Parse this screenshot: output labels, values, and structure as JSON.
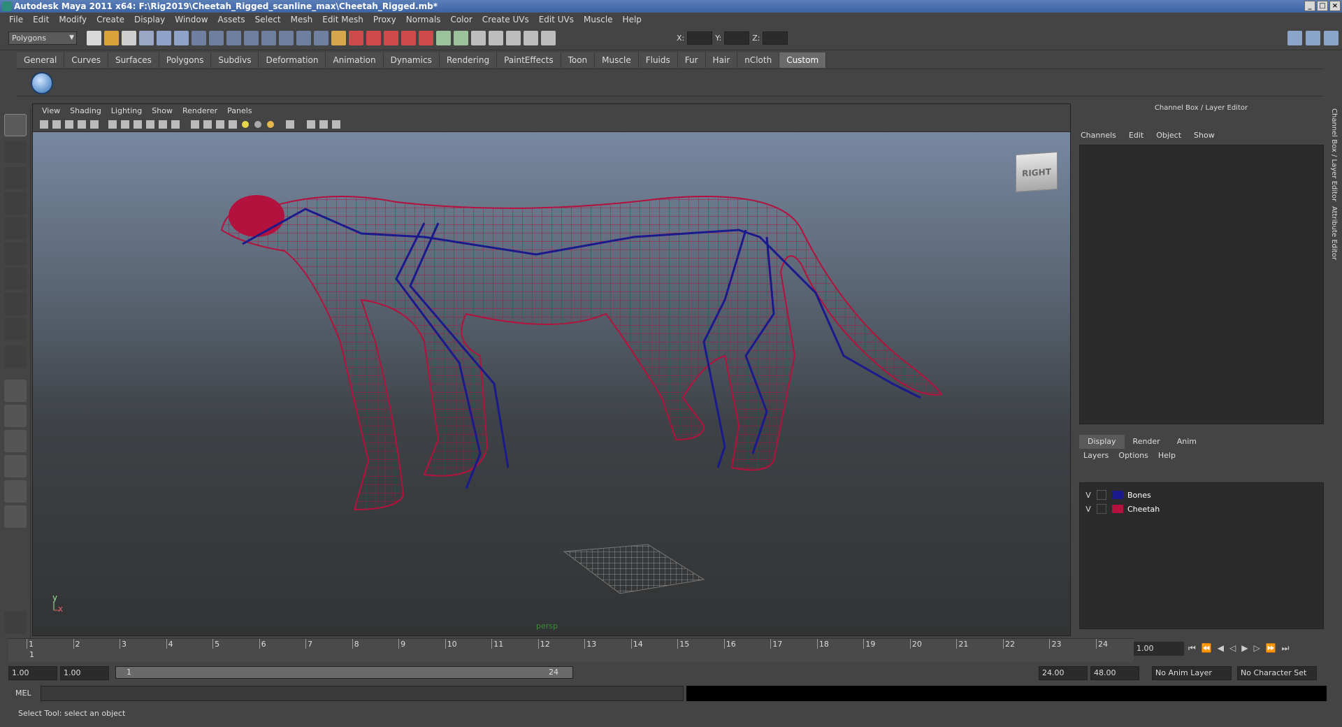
{
  "window": {
    "title": "Autodesk Maya 2011 x64: F:\\Rig2019\\Cheetah_Rigged_scanline_max\\Cheetah_Rigged.mb*"
  },
  "menu": [
    "File",
    "Edit",
    "Modify",
    "Create",
    "Display",
    "Window",
    "Assets",
    "Select",
    "Mesh",
    "Edit Mesh",
    "Proxy",
    "Normals",
    "Color",
    "Create UVs",
    "Edit UVs",
    "Muscle",
    "Help"
  ],
  "status_line": {
    "mode": "Polygons",
    "x_label": "X:",
    "y_label": "Y:",
    "z_label": "Z:"
  },
  "shelf_tabs": [
    "General",
    "Curves",
    "Surfaces",
    "Polygons",
    "Subdivs",
    "Deformation",
    "Animation",
    "Dynamics",
    "Rendering",
    "PaintEffects",
    "Toon",
    "Muscle",
    "Fluids",
    "Fur",
    "Hair",
    "nCloth",
    "Custom"
  ],
  "active_shelf": "Custom",
  "viewport": {
    "menu": [
      "View",
      "Shading",
      "Lighting",
      "Show",
      "Renderer",
      "Panels"
    ],
    "camera_label": "persp",
    "viewcube_face": "RIGHT",
    "axis_y": "y",
    "axis_x": "x"
  },
  "channel_box": {
    "title": "Channel Box / Layer Editor",
    "menu": [
      "Channels",
      "Edit",
      "Object",
      "Show"
    ]
  },
  "layer_editor": {
    "tabs": [
      "Display",
      "Render",
      "Anim"
    ],
    "active_tab": "Display",
    "menu": [
      "Layers",
      "Options",
      "Help"
    ],
    "layers": [
      {
        "visible": "V",
        "name": "Bones",
        "color": "#1a1a8c"
      },
      {
        "visible": "V",
        "name": "Cheetah",
        "color": "#b3123e"
      }
    ]
  },
  "side_tabs": [
    "Channel Box / Layer Editor",
    "Attribute Editor"
  ],
  "timeline": {
    "ticks": [
      "1",
      "2",
      "3",
      "4",
      "5",
      "6",
      "7",
      "8",
      "9",
      "10",
      "11",
      "12",
      "13",
      "14",
      "15",
      "16",
      "17",
      "18",
      "19",
      "20",
      "21",
      "22",
      "23",
      "24"
    ],
    "current_marker": "1",
    "current_frame": "1.00"
  },
  "range": {
    "start": "1.00",
    "playback_start": "1.00",
    "slider_start": "1",
    "slider_end": "24",
    "playback_end": "24.00",
    "end": "48.00",
    "anim_layer": "No Anim Layer",
    "character_set": "No Character Set"
  },
  "command_line": {
    "label": "MEL"
  },
  "help_line": "Select Tool: select an object",
  "colors": {
    "mesh": "#b3123e",
    "bones": "#1a1a8c",
    "accent": "#3d63a3"
  }
}
